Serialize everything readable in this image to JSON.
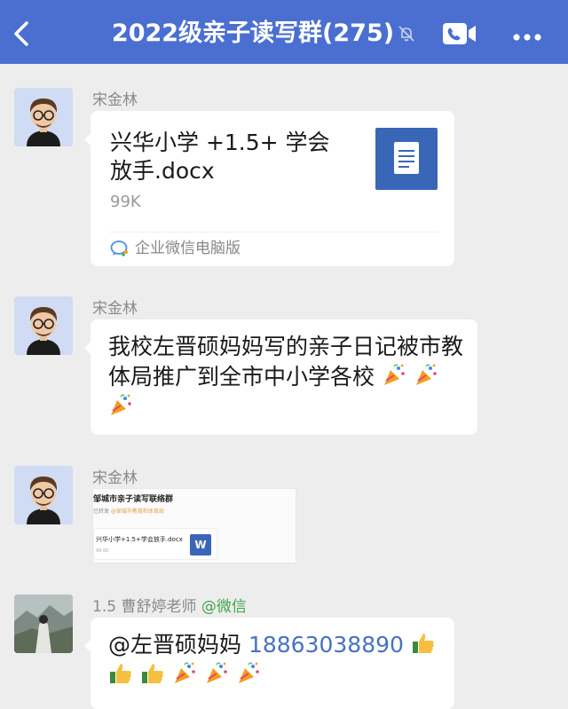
{
  "header": {
    "title": "2022级亲子读写群(275)",
    "back_icon": "chevron-left-icon",
    "mute_icon": "bell-off-icon",
    "video_icon": "video-call-icon",
    "more_icon": "more-dots-icon",
    "background": "#4a6fd1"
  },
  "messages": [
    {
      "sender": "宋金林",
      "type": "file",
      "file_name": "兴华小学 +1.5+ 学会放手.docx",
      "file_size": "99K",
      "source": "企业微信电脑版"
    },
    {
      "sender": "宋金林",
      "type": "text",
      "text": "我校左晋硕妈妈写的亲子日记被市教体局推广到全市中小学各校"
    },
    {
      "sender": "宋金林",
      "type": "image",
      "image_title": "邹城市亲子读写联络群",
      "image_sub_a": "已转发 ",
      "image_sub_b": "@邹城市教育和体育局",
      "image_file_name": "兴华小学+1.5+学会放手.docx",
      "image_file_size": "99.6K",
      "image_file_icon": "W"
    },
    {
      "sender": "1.5 曹舒婷老师",
      "sender_suffix": "@微信",
      "type": "text",
      "mention": "@左晋硕妈妈 ",
      "phone": "18863038890"
    }
  ],
  "colors": {
    "bubble": "#ffffff",
    "chat_background": "#ededed",
    "link": "#4672c4",
    "wechat_tag": "#3fa64a"
  }
}
